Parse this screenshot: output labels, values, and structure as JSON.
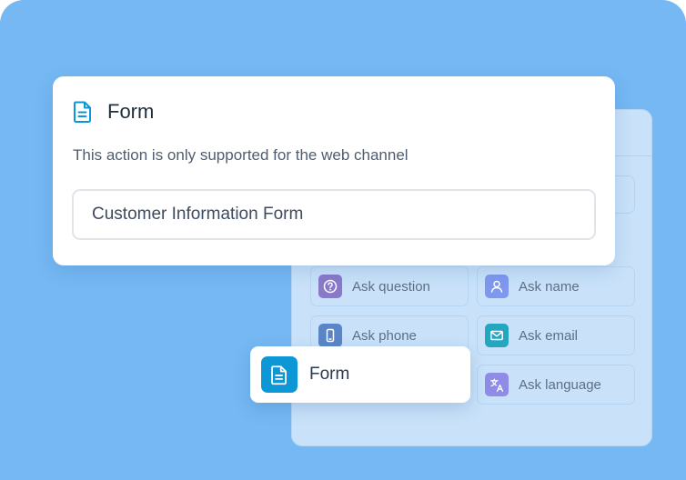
{
  "form_card": {
    "title": "Form",
    "description": "This action is only supported for the web channel",
    "field_value": "Customer Information Form"
  },
  "actions": [
    {
      "label": "Ask question",
      "icon": "question-icon",
      "color": "#8a79c9"
    },
    {
      "label": "Ask name",
      "icon": "user-icon",
      "color": "#7f98ef"
    },
    {
      "label": "Ask phone",
      "icon": "phone-icon",
      "color": "#5a86c7"
    },
    {
      "label": "Ask email",
      "icon": "mail-icon",
      "color": "#25a6c0"
    },
    {
      "label": "Ask language",
      "icon": "translate-icon",
      "color": "#8f8ce8"
    }
  ],
  "drag_chip": {
    "label": "Form",
    "icon": "document-icon",
    "color": "#0d97d6"
  }
}
